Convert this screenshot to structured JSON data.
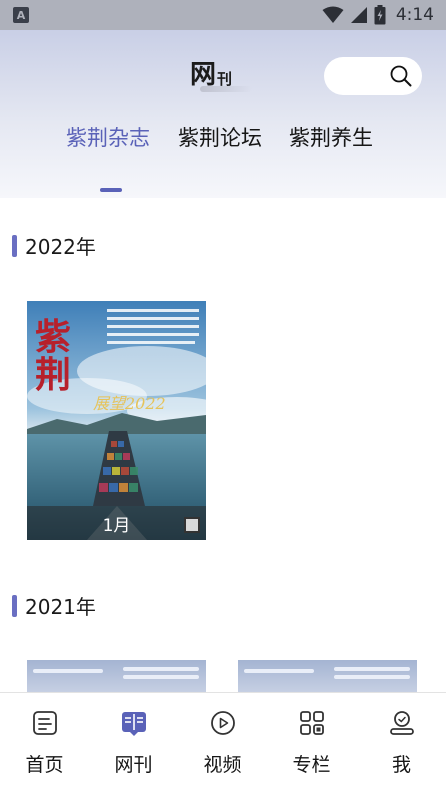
{
  "status_bar": {
    "app_badge": "A",
    "time": "4:14"
  },
  "header": {
    "logo_main": "网",
    "logo_sub": "刊",
    "search_icon": "search-icon"
  },
  "tabs": [
    {
      "label": "紫荆杂志",
      "active": true
    },
    {
      "label": "紫荆论坛",
      "active": false
    },
    {
      "label": "紫荆养生",
      "active": false
    }
  ],
  "sections": [
    {
      "year": "2022年",
      "issues": [
        {
          "label": "1月",
          "cover": {
            "masthead": "紫荆",
            "headline": "展望2022"
          }
        }
      ]
    },
    {
      "year": "2021年",
      "issues": []
    }
  ],
  "bottom_nav": [
    {
      "label": "首页",
      "icon": "document-icon"
    },
    {
      "label": "网刊",
      "icon": "magazine-icon",
      "active": true
    },
    {
      "label": "视频",
      "icon": "play-icon"
    },
    {
      "label": "专栏",
      "icon": "grid-icon"
    },
    {
      "label": "我",
      "icon": "profile-icon"
    }
  ],
  "colors": {
    "accent": "#5a62b8",
    "header_top": "#c9cfe6",
    "status_bar": "#aeb1bb"
  }
}
